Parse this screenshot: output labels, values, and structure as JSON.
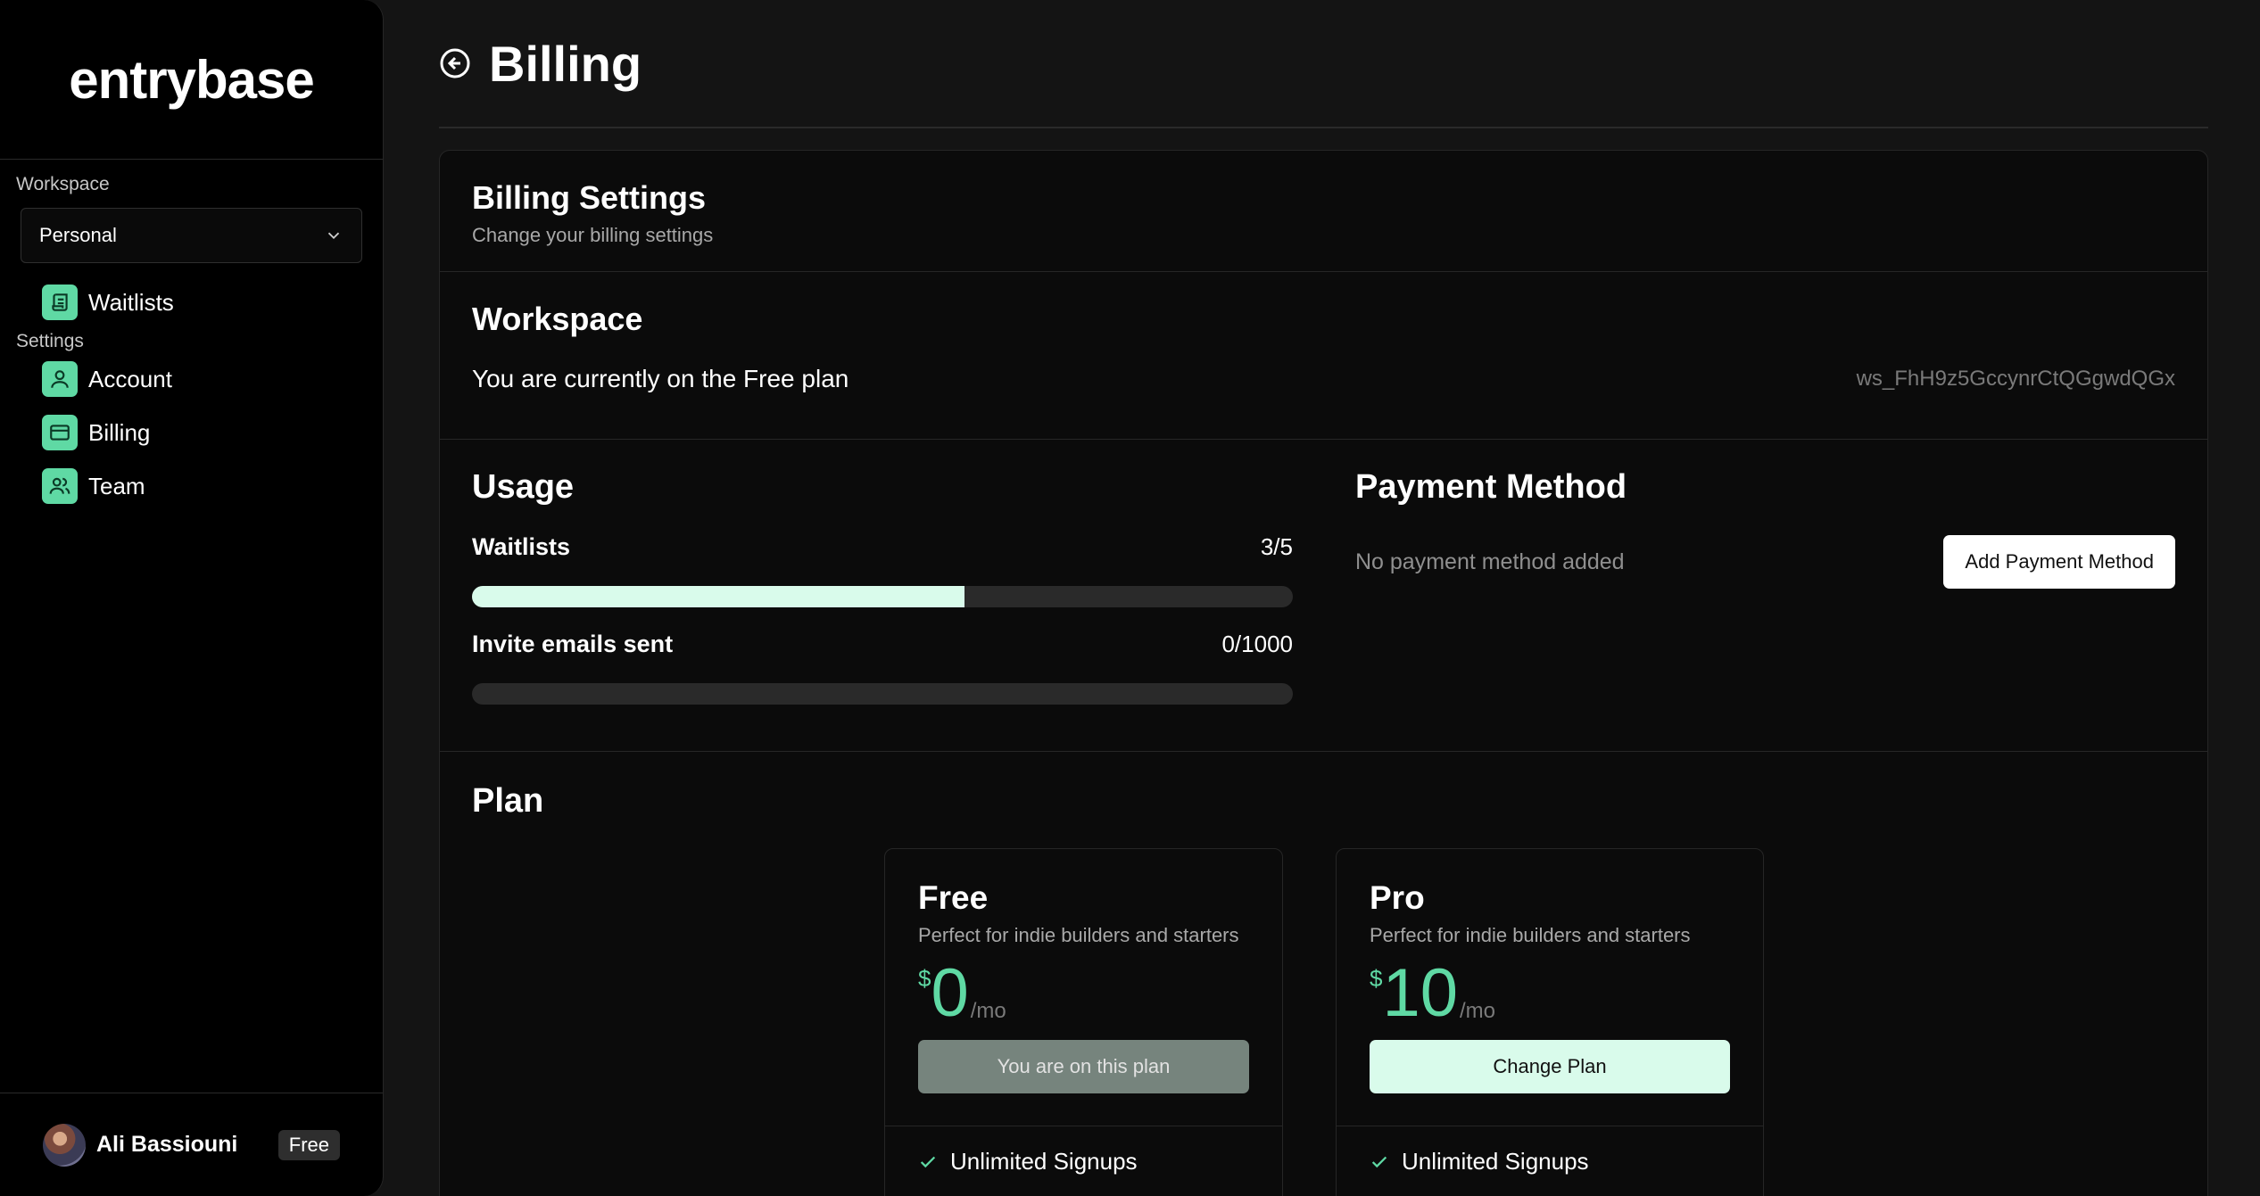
{
  "brand": {
    "logo": "entrybase",
    "accent": "#5fd9a4"
  },
  "sidebar": {
    "workspace_label": "Workspace",
    "workspace_selected": "Personal",
    "items": [
      {
        "label": "Waitlists",
        "icon": "scroll-icon"
      }
    ],
    "settings_label": "Settings",
    "settings_items": [
      {
        "label": "Account",
        "icon": "user-icon"
      },
      {
        "label": "Billing",
        "icon": "credit-card-icon"
      },
      {
        "label": "Team",
        "icon": "users-icon"
      }
    ],
    "user": {
      "name": "Ali Bassiouni",
      "plan_badge": "Free"
    }
  },
  "header": {
    "title": "Billing"
  },
  "billing_settings": {
    "title": "Billing Settings",
    "subtitle": "Change your billing settings"
  },
  "workspace": {
    "title": "Workspace",
    "current_plan_text": "You are currently on the Free plan",
    "workspace_id": "ws_FhH9z5GccynrCtQGgwdQGx"
  },
  "usage": {
    "title": "Usage",
    "meters": [
      {
        "label": "Waitlists",
        "count": "3/5",
        "used": 3,
        "limit": 5
      },
      {
        "label": "Invite emails sent",
        "count": "0/1000",
        "used": 0,
        "limit": 1000
      }
    ]
  },
  "payment": {
    "title": "Payment Method",
    "empty_text": "No payment method added",
    "add_button": "Add Payment Method"
  },
  "plan": {
    "title": "Plan",
    "cards": [
      {
        "name": "Free",
        "description": "Perfect for indie builders and starters",
        "currency": "$",
        "amount": "0",
        "period": "/mo",
        "button": "You are on this plan",
        "feature": "Unlimited Signups"
      },
      {
        "name": "Pro",
        "description": "Perfect for indie builders and starters",
        "currency": "$",
        "amount": "10",
        "period": "/mo",
        "button": "Change Plan",
        "feature": "Unlimited Signups"
      }
    ]
  }
}
